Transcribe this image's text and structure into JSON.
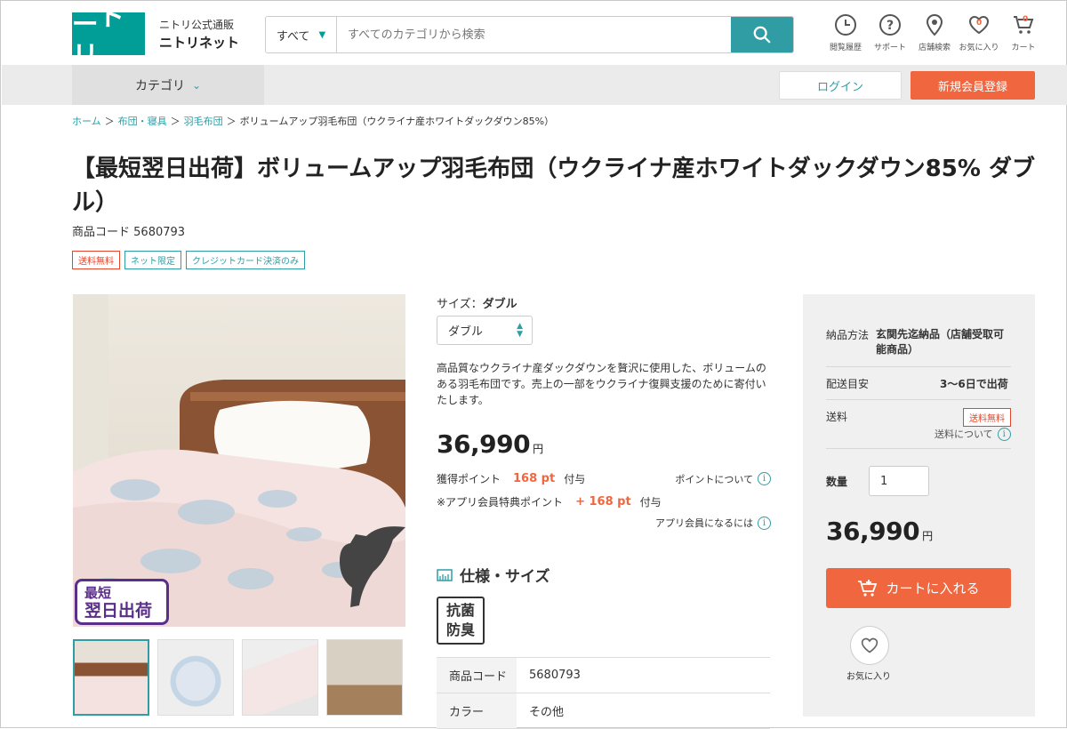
{
  "header": {
    "logo_text": "ニトリ",
    "brand_line1": "ニトリ公式通販",
    "brand_line2": "ニトリネット",
    "search_scope": "すべて",
    "search_placeholder": "すべてのカテゴリから検索",
    "icons": [
      {
        "label": "閲覧履歴",
        "icon": "history-icon"
      },
      {
        "label": "サポート",
        "icon": "help-icon"
      },
      {
        "label": "店舗検索",
        "icon": "location-icon"
      },
      {
        "label": "お気に入り",
        "icon": "heart-icon",
        "count": "0"
      },
      {
        "label": "カート",
        "icon": "cart-icon",
        "count": "0"
      }
    ]
  },
  "nav": {
    "category_label": "カテゴリ",
    "login_label": "ログイン",
    "signup_label": "新規会員登録"
  },
  "breadcrumb": [
    "ホーム",
    "布団・寝具",
    "羽毛布団",
    "ボリュームアップ羽毛布団（ウクライナ産ホワイトダックダウン85%）"
  ],
  "product": {
    "title": "【最短翌日出荷】ボリュームアップ羽毛布団（ウクライナ産ホワイトダックダウン85% ダブル）",
    "code_label": "商品コード",
    "code": "5680793",
    "badges": [
      "送料無料",
      "ネット限定",
      "クレジットカード決済のみ"
    ],
    "image_overlay_line1": "最短",
    "image_overlay_line2": "翌日出荷",
    "size_label": "サイズ：",
    "size_value": "ダブル",
    "size_select": "ダブル",
    "description": "高品質なウクライナ産ダックダウンを贅沢に使用した、ボリュームのある羽毛布団です。売上の一部をウクライナ復興支援のために寄付いたします。",
    "price": "36,990",
    "currency": "円",
    "points_label": "獲得ポイント",
    "points_value": "168 pt",
    "points_suffix": "付与",
    "points_link": "ポイントについて",
    "app_points_label": "※アプリ会員特典ポイント",
    "app_points_value": "+ 168 pt",
    "app_points_suffix": "付与",
    "app_link": "アプリ会員になるには",
    "spec_heading": "仕様・サイズ",
    "feature_icon_line1": "抗菌",
    "feature_icon_line2": "防臭",
    "spec_rows": [
      {
        "key": "商品コード",
        "value": "5680793"
      },
      {
        "key": "カラー",
        "value": "その他"
      }
    ]
  },
  "sidebar": {
    "delivery_method_label": "納品方法",
    "delivery_method_value": "玄関先迄納品（店舗受取可能商品）",
    "delivery_eta_label": "配送目安",
    "delivery_eta_value": "3～6日で出荷",
    "shipping_label": "送料",
    "shipping_badge": "送料無料",
    "shipping_link": "送料について",
    "qty_label": "数量",
    "qty_value": "1",
    "price": "36,990",
    "currency": "円",
    "cart_button": "カートに入れる",
    "favorite_label": "お気に入り"
  },
  "colors": {
    "brand": "#009e96",
    "accent": "#f0663f",
    "teal": "#2f9da3"
  }
}
